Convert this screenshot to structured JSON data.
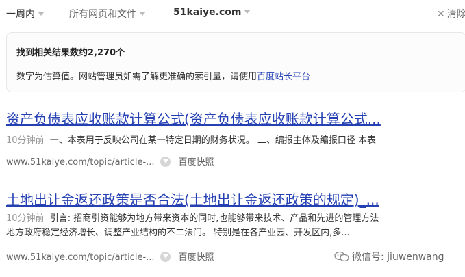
{
  "filters": {
    "time": "一周内",
    "type": "所有网页和文件",
    "site": "51kaiye.com",
    "clear": "清除"
  },
  "info": {
    "count_text": "找到相关结果数约2,270个",
    "note_text": "数字为估算值。网站管理员如需了解更准确的索引量，请使用",
    "note_link": "百度站长平台"
  },
  "results": [
    {
      "title": "资产负债表应收账款计算公式(资产负债表应收账款计算公式...",
      "time": "10分钟前",
      "snippet": "一、本表用于反映公司在某一特定日期的财务状况。 二、编报主体及编报口径 本表",
      "url": "www.51kaiye.com/topic/article-...",
      "cache": "百度快照"
    },
    {
      "title": "土地出让金返还政策是否合法(土地出让金返还政策的规定)_...",
      "time": "10分钟前",
      "snippet_line1": "引言: 招商引资能够为地方带来资本的同时,也能够带来技术、产品和先进的管理方法",
      "snippet_line2": "地方政府稳定经济增长、调整产业结构的不二法门。 特别是在各产业园、开发区内,多...",
      "url": "www.51kaiye.com/topic/article-...",
      "cache": "百度快照"
    }
  ],
  "watermark": {
    "text": "微信号: jiuwenwang"
  }
}
